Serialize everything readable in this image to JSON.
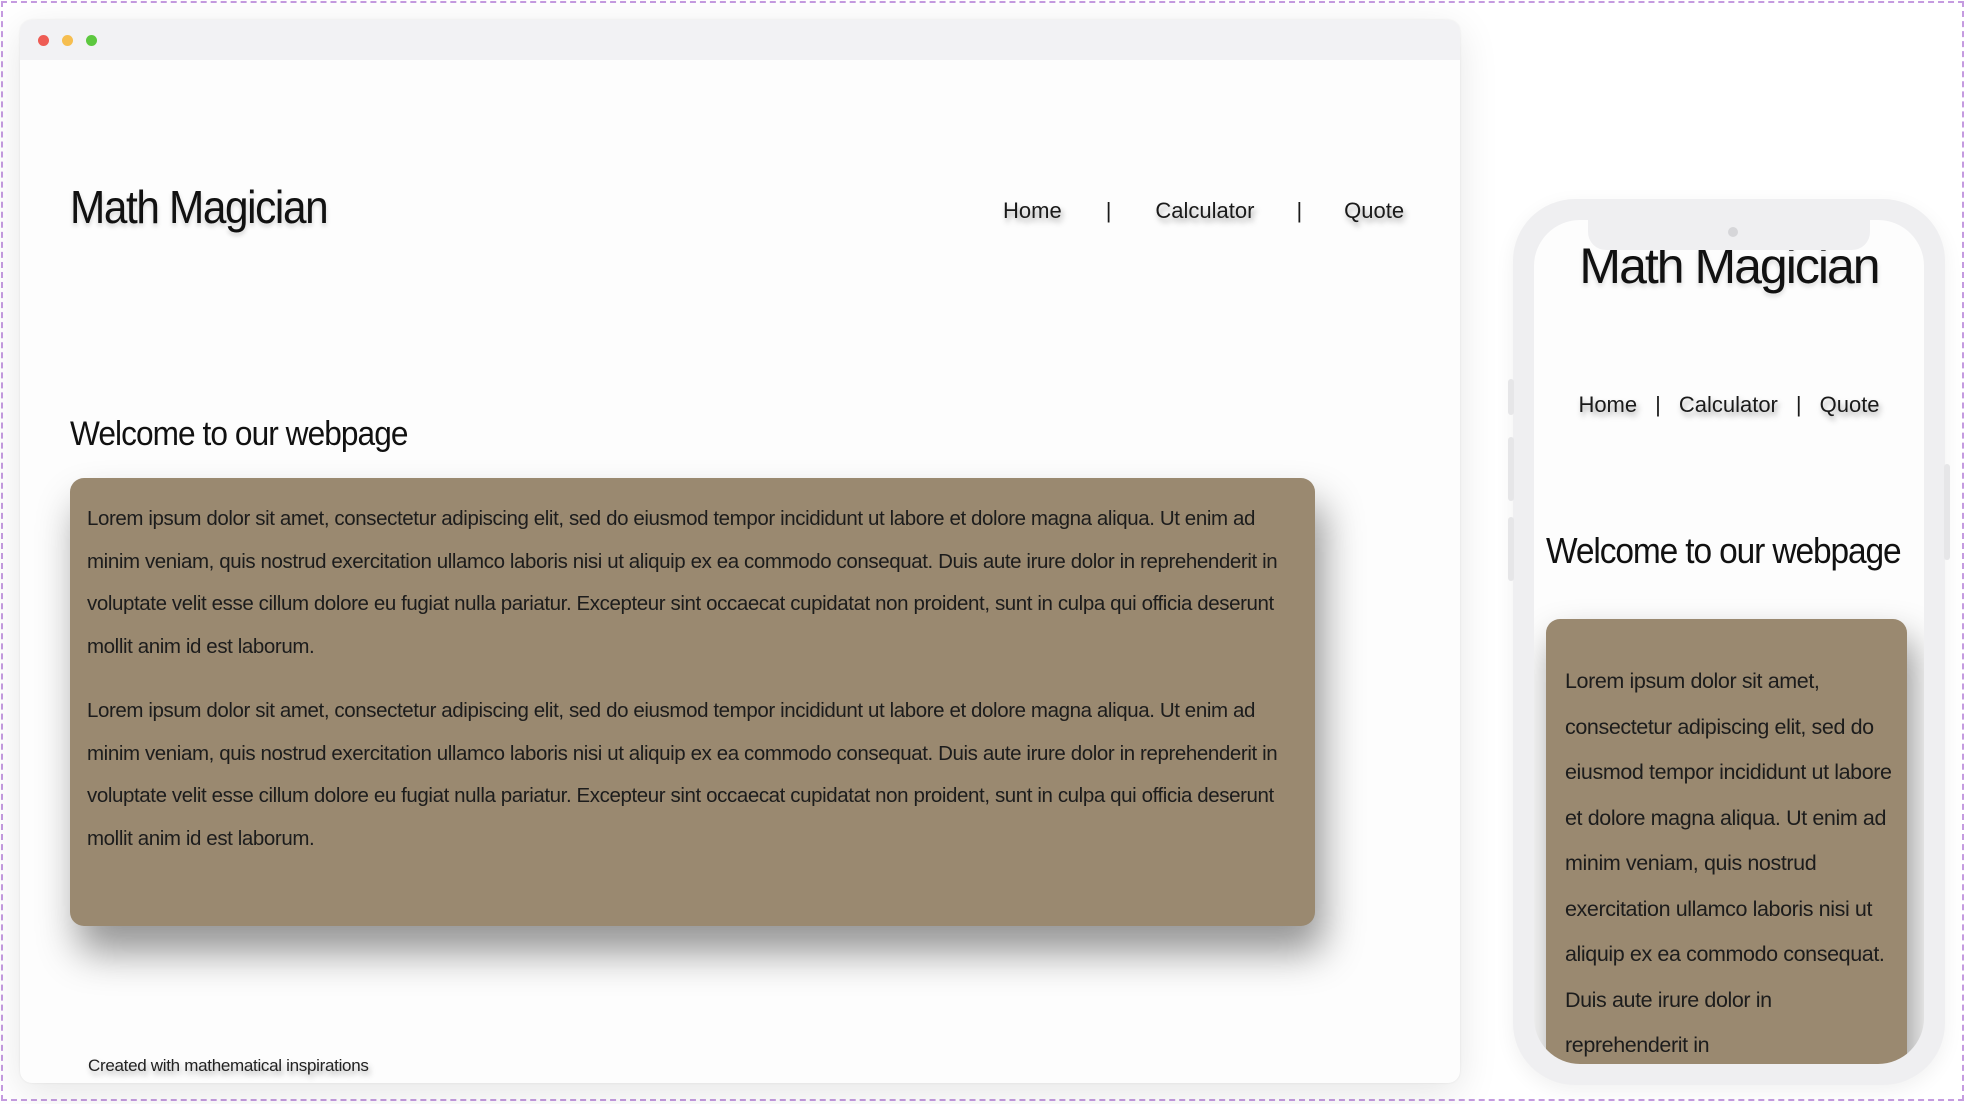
{
  "site": {
    "title": "Math Magician",
    "nav": {
      "home": "Home",
      "calculator": "Calculator",
      "quote": "Quote",
      "separator": "|"
    },
    "welcome_heading": "Welcome to our webpage",
    "paragraphs": [
      "Lorem ipsum dolor sit amet, consectetur adipiscing elit, sed do eiusmod tempor incididunt ut labore et dolore magna aliqua. Ut enim ad minim veniam, quis nostrud exercitation ullamco laboris nisi ut aliquip ex ea commodo consequat. Duis aute irure dolor in reprehenderit in voluptate velit esse cillum dolore eu fugiat nulla pariatur. Excepteur sint occaecat cupidatat non proident, sunt in culpa qui officia deserunt mollit anim id est laborum.",
      "Lorem ipsum dolor sit amet, consectetur adipiscing elit, sed do eiusmod tempor incididunt ut labore et dolore magna aliqua. Ut enim ad minim veniam, quis nostrud exercitation ullamco laboris nisi ut aliquip ex ea commodo consequat. Duis aute irure dolor in reprehenderit in voluptate velit esse cillum dolore eu fugiat nulla pariatur. Excepteur sint occaecat cupidatat non proident, sunt in culpa qui officia deserunt mollit anim id est laborum."
    ],
    "mobile_paragraph": "Lorem ipsum dolor sit amet, consectetur adipiscing elit, sed do eiusmod tempor incididunt ut labore et dolore magna aliqua. Ut enim ad minim veniam, quis nostrud exercitation ullamco laboris nisi ut aliquip ex ea commodo consequat. Duis aute irure dolor in reprehenderit in",
    "footer": "Created with mathematical inspirations"
  },
  "colors": {
    "card_background": "#9a8970",
    "window_chrome": "#f2f2f4",
    "traffic_red": "#ee5c54",
    "traffic_yellow": "#f6be4f",
    "traffic_green": "#5dc83f"
  }
}
